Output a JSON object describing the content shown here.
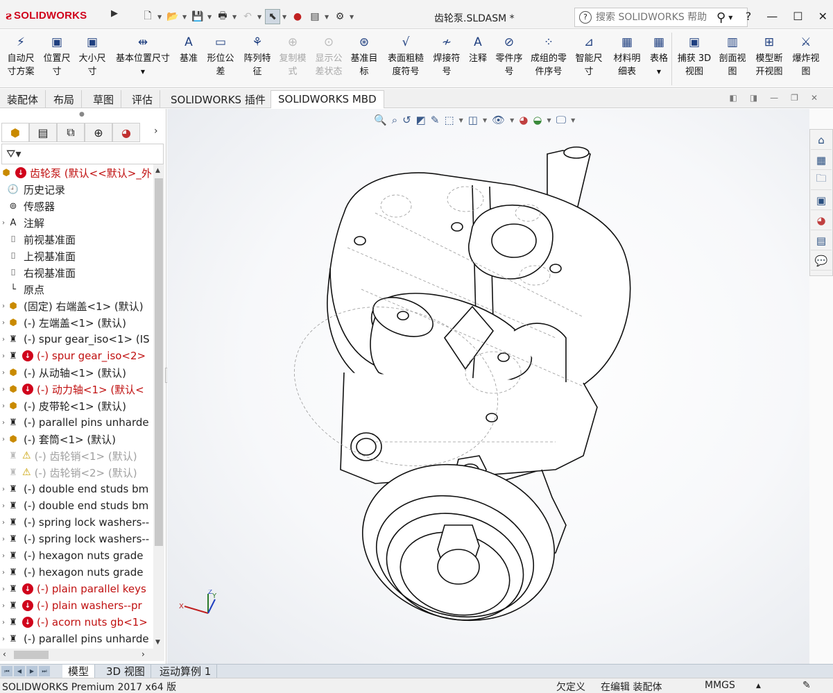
{
  "app": {
    "brand": "SOLIDWORKS",
    "doc_title": "齿轮泵.SLDASM *",
    "search_placeholder": "搜索 SOLIDWORKS 帮助",
    "help_label": "?",
    "accent": "#d0021b"
  },
  "ribbon": {
    "buttons": [
      {
        "label": "自动尺\n寸方案",
        "icon": "auto-dimension-icon",
        "enabled": true
      },
      {
        "label": "位置尺\n寸",
        "icon": "location-dimension-icon",
        "enabled": true
      },
      {
        "label": "大小尺\n寸",
        "icon": "size-dimension-icon",
        "enabled": true
      },
      {
        "label": "基本位置尺寸",
        "icon": "basic-location-dimension-icon",
        "enabled": true
      },
      {
        "label": "基准",
        "icon": "datum-icon",
        "enabled": true
      },
      {
        "label": "形位公\n差",
        "icon": "geometric-tolerance-icon",
        "enabled": true
      },
      {
        "label": "阵列特\n征",
        "icon": "pattern-feature-icon",
        "enabled": true
      },
      {
        "label": "复制模\n式",
        "icon": "copy-scheme-icon",
        "enabled": false
      },
      {
        "label": "显示公\n差状态",
        "icon": "show-tolerance-status-icon",
        "enabled": false
      },
      {
        "label": "基准目\n标",
        "icon": "datum-target-icon",
        "enabled": true
      },
      {
        "label": "表面粗糙\n度符号",
        "icon": "surface-finish-icon",
        "enabled": true
      },
      {
        "label": "焊接符\n号",
        "icon": "weld-symbol-icon",
        "enabled": true
      },
      {
        "label": "注释",
        "icon": "note-icon",
        "enabled": true
      },
      {
        "label": "零件序\n号",
        "icon": "balloon-icon",
        "enabled": true
      },
      {
        "label": "成组的零\n件序号",
        "icon": "stacked-balloon-icon",
        "enabled": true
      },
      {
        "label": "智能尺\n寸",
        "icon": "smart-dimension-icon",
        "enabled": true
      },
      {
        "label": "材料明\n细表",
        "icon": "bom-icon",
        "enabled": true
      },
      {
        "label": "表格",
        "icon": "table-icon",
        "enabled": true
      },
      {
        "label": "捕获 3D\n视图",
        "icon": "capture-3d-view-icon",
        "enabled": true
      },
      {
        "label": "剖面视\n图",
        "icon": "section-view-icon",
        "enabled": true
      },
      {
        "label": "模型断\n开视图",
        "icon": "model-break-view-icon",
        "enabled": true
      },
      {
        "label": "爆炸视\n图",
        "icon": "explode-view-icon",
        "enabled": true
      }
    ]
  },
  "tabs": [
    "装配体",
    "布局",
    "草图",
    "评估",
    "SOLIDWORKS 插件",
    "SOLIDWORKS MBD"
  ],
  "active_tab": "SOLIDWORKS MBD",
  "tree": {
    "root": "齿轮泵  (默认<<默认>_外",
    "items": [
      {
        "label": "历史记录",
        "icon": "history-icon",
        "expand": false,
        "state": "normal"
      },
      {
        "label": "传感器",
        "icon": "sensor-icon",
        "expand": false,
        "state": "normal"
      },
      {
        "label": "注解",
        "icon": "annotations-icon",
        "expand": true,
        "state": "normal"
      },
      {
        "label": "前视基准面",
        "icon": "plane-icon",
        "expand": false,
        "state": "normal"
      },
      {
        "label": "上视基准面",
        "icon": "plane-icon",
        "expand": false,
        "state": "normal"
      },
      {
        "label": "右视基准面",
        "icon": "plane-icon",
        "expand": false,
        "state": "normal"
      },
      {
        "label": "原点",
        "icon": "origin-icon",
        "expand": false,
        "state": "normal"
      },
      {
        "label": "(固定) 右端盖<1> (默认)",
        "icon": "subassembly-icon",
        "expand": true,
        "state": "normal"
      },
      {
        "label": "(-) 左端盖<1> (默认)",
        "icon": "subassembly-icon",
        "expand": true,
        "state": "normal"
      },
      {
        "label": "(-) spur gear_iso<1> (IS",
        "icon": "part-icon",
        "expand": true,
        "state": "normal"
      },
      {
        "label": "(-) spur gear_iso<2>",
        "icon": "part-icon",
        "expand": true,
        "state": "error"
      },
      {
        "label": "(-) 从动轴<1> (默认)",
        "icon": "subassembly-icon",
        "expand": true,
        "state": "normal"
      },
      {
        "label": "(-) 动力轴<1> (默认<",
        "icon": "subassembly-icon",
        "expand": true,
        "state": "error"
      },
      {
        "label": "(-) 皮带轮<1> (默认)",
        "icon": "subassembly-icon",
        "expand": true,
        "state": "normal"
      },
      {
        "label": "(-) parallel pins unharde",
        "icon": "part-icon",
        "expand": true,
        "state": "normal"
      },
      {
        "label": "(-) 套筒<1> (默认)",
        "icon": "subassembly-icon",
        "expand": true,
        "state": "normal"
      },
      {
        "label": "(-) 齿轮销<1> (默认)",
        "icon": "suppressed-icon",
        "expand": false,
        "state": "warning"
      },
      {
        "label": "(-) 齿轮销<2> (默认)",
        "icon": "suppressed-icon",
        "expand": false,
        "state": "warning"
      },
      {
        "label": "(-) double end studs bm",
        "icon": "part-icon",
        "expand": true,
        "state": "normal"
      },
      {
        "label": "(-) double end studs bm",
        "icon": "part-icon",
        "expand": true,
        "state": "normal"
      },
      {
        "label": "(-) spring lock washers--",
        "icon": "part-icon",
        "expand": true,
        "state": "normal"
      },
      {
        "label": "(-) spring lock washers--",
        "icon": "part-icon",
        "expand": true,
        "state": "normal"
      },
      {
        "label": "(-) hexagon nuts grade",
        "icon": "part-icon",
        "expand": true,
        "state": "normal"
      },
      {
        "label": "(-) hexagon nuts grade",
        "icon": "part-icon",
        "expand": true,
        "state": "normal"
      },
      {
        "label": "(-) plain parallel keys",
        "icon": "part-icon",
        "expand": true,
        "state": "error"
      },
      {
        "label": "(-) plain washers--pr",
        "icon": "part-icon",
        "expand": true,
        "state": "error"
      },
      {
        "label": "(-) acorn nuts gb<1>",
        "icon": "part-icon",
        "expand": true,
        "state": "error"
      },
      {
        "label": "(-) parallel pins unharde",
        "icon": "part-icon",
        "expand": true,
        "state": "normal"
      }
    ]
  },
  "bottom_tabs": [
    "模型",
    "3D 视图",
    "运动算例 1"
  ],
  "status": {
    "product": "SOLIDWORKS Premium 2017 x64 版",
    "under_defined": "欠定义",
    "editing": "在编辑 装配体",
    "units": "MMGS"
  },
  "triad": {
    "x": "X",
    "y": "Y",
    "z": "Z"
  }
}
